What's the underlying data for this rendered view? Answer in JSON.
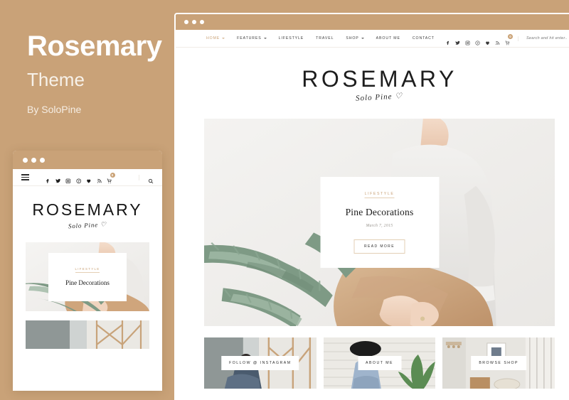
{
  "promo": {
    "title": "Rosemary",
    "subtitle": "Theme",
    "byline": "By SoloPine"
  },
  "colors": {
    "background": "#c9a278",
    "accent": "#caa276",
    "text_dark": "#1d1d1d",
    "muted": "#9a958f",
    "border_accent": "#e3cfb5"
  },
  "desktop": {
    "window_dots": [
      "dot-1",
      "dot-2",
      "dot-3"
    ],
    "nav": {
      "links": [
        {
          "label": "HOME",
          "has_dropdown": true,
          "active": true
        },
        {
          "label": "FEATURES",
          "has_dropdown": true,
          "active": false
        },
        {
          "label": "LIFESTYLE",
          "has_dropdown": false,
          "active": false
        },
        {
          "label": "TRAVEL",
          "has_dropdown": false,
          "active": false
        },
        {
          "label": "SHOP",
          "has_dropdown": true,
          "active": false
        },
        {
          "label": "ABOUT ME",
          "has_dropdown": false,
          "active": false
        },
        {
          "label": "CONTACT",
          "has_dropdown": false,
          "active": false
        }
      ],
      "social": [
        "facebook-icon",
        "twitter-icon",
        "instagram-icon",
        "pinterest-icon",
        "bloglovin-heart-icon",
        "rss-icon"
      ],
      "cart": {
        "icon": "shopping-cart-icon",
        "badge_count": "0"
      },
      "search": {
        "placeholder": "Search and hit enter...",
        "value": "",
        "icon": "search-icon"
      }
    },
    "logo": {
      "main": "ROSEMARY",
      "script": "Solo Pine ♡"
    },
    "hero_post": {
      "category": "LIFESTYLE",
      "title": "Pine Decorations",
      "date": "March 7, 2015",
      "button": "READ MORE",
      "image_alt": "woman-holding-pine-bouquet"
    },
    "promo_boxes": [
      {
        "label": "FOLLOW @ INSTAGRAM",
        "image_alt": "woman-by-window"
      },
      {
        "label": "ABOUT ME",
        "image_alt": "woman-in-black-hat"
      },
      {
        "label": "BROWSE SHOP",
        "image_alt": "interior-room-shelf"
      }
    ]
  },
  "mobile": {
    "window_dots": [
      "dot-1",
      "dot-2",
      "dot-3"
    ],
    "nav": {
      "menu_icon": "hamburger-menu-icon",
      "social": [
        "facebook-icon",
        "twitter-icon",
        "instagram-icon",
        "pinterest-icon",
        "bloglovin-heart-icon",
        "rss-icon"
      ],
      "cart": {
        "icon": "shopping-cart-icon",
        "badge_count": "0"
      },
      "search_icon": "search-icon"
    },
    "logo": {
      "main": "ROSEMARY",
      "script": "Solo Pine ♡"
    },
    "hero_post": {
      "category": "LIFESTYLE",
      "title": "Pine Decorations",
      "image_alt": "woman-holding-pine-bouquet"
    },
    "strip_image_alt": "woman-by-window"
  }
}
